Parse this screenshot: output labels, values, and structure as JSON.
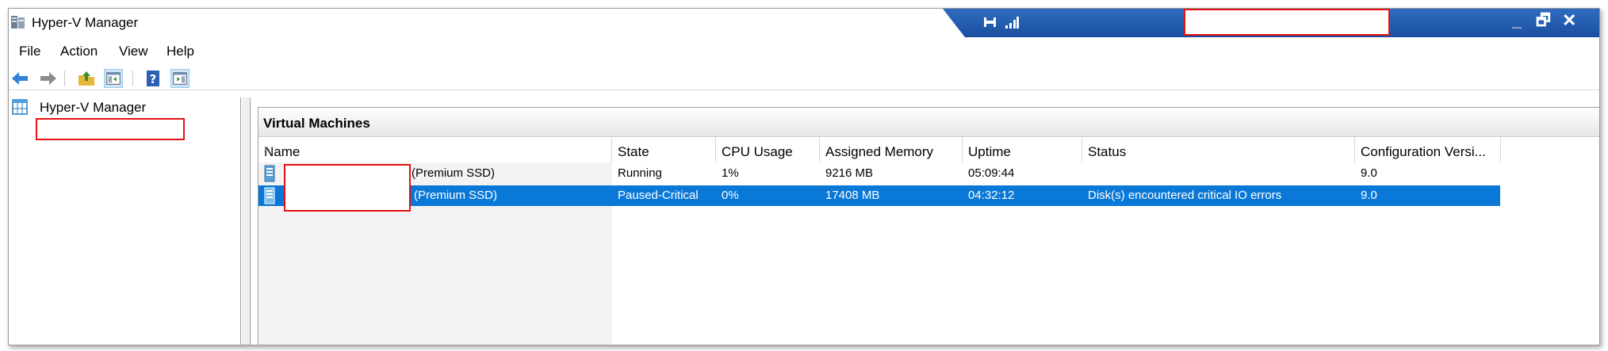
{
  "window": {
    "title": "Hyper-V Manager",
    "icon": "hyperv-manager-icon",
    "controls": {
      "minimize": "_",
      "restore": "🗗",
      "close": "✕"
    }
  },
  "menu": [
    "File",
    "Action",
    "View",
    "Help"
  ],
  "toolbar": [
    "back-arrow-icon",
    "forward-arrow-icon",
    "up-folder-icon",
    "show-hide-console-tree-icon",
    "help-icon",
    "show-hide-action-pane-icon"
  ],
  "tree": {
    "root_label": "Hyper-V Manager"
  },
  "panel": {
    "title": "Virtual Machines",
    "sort_indicator": "^",
    "columns": [
      "Name",
      "State",
      "CPU Usage",
      "Assigned Memory",
      "Uptime",
      "Status",
      "Configuration Versi..."
    ],
    "rows": [
      {
        "name_suffix": "(Premium SSD)",
        "state": "Running",
        "cpu": "1%",
        "memory": "9216 MB",
        "uptime": "05:09:44",
        "status": "",
        "config": "9.0",
        "selected": false
      },
      {
        "name_suffix": "(Premium SSD)",
        "state": "Paused-Critical",
        "cpu": "0%",
        "memory": "17408 MB",
        "uptime": "04:32:12",
        "status": "Disk(s) encountered critical IO errors",
        "config": "9.0",
        "selected": true
      }
    ]
  },
  "colors": {
    "selection": "#0a78d7",
    "redaction_border": "#e81010",
    "remote_bar": "#1f5aaa"
  }
}
